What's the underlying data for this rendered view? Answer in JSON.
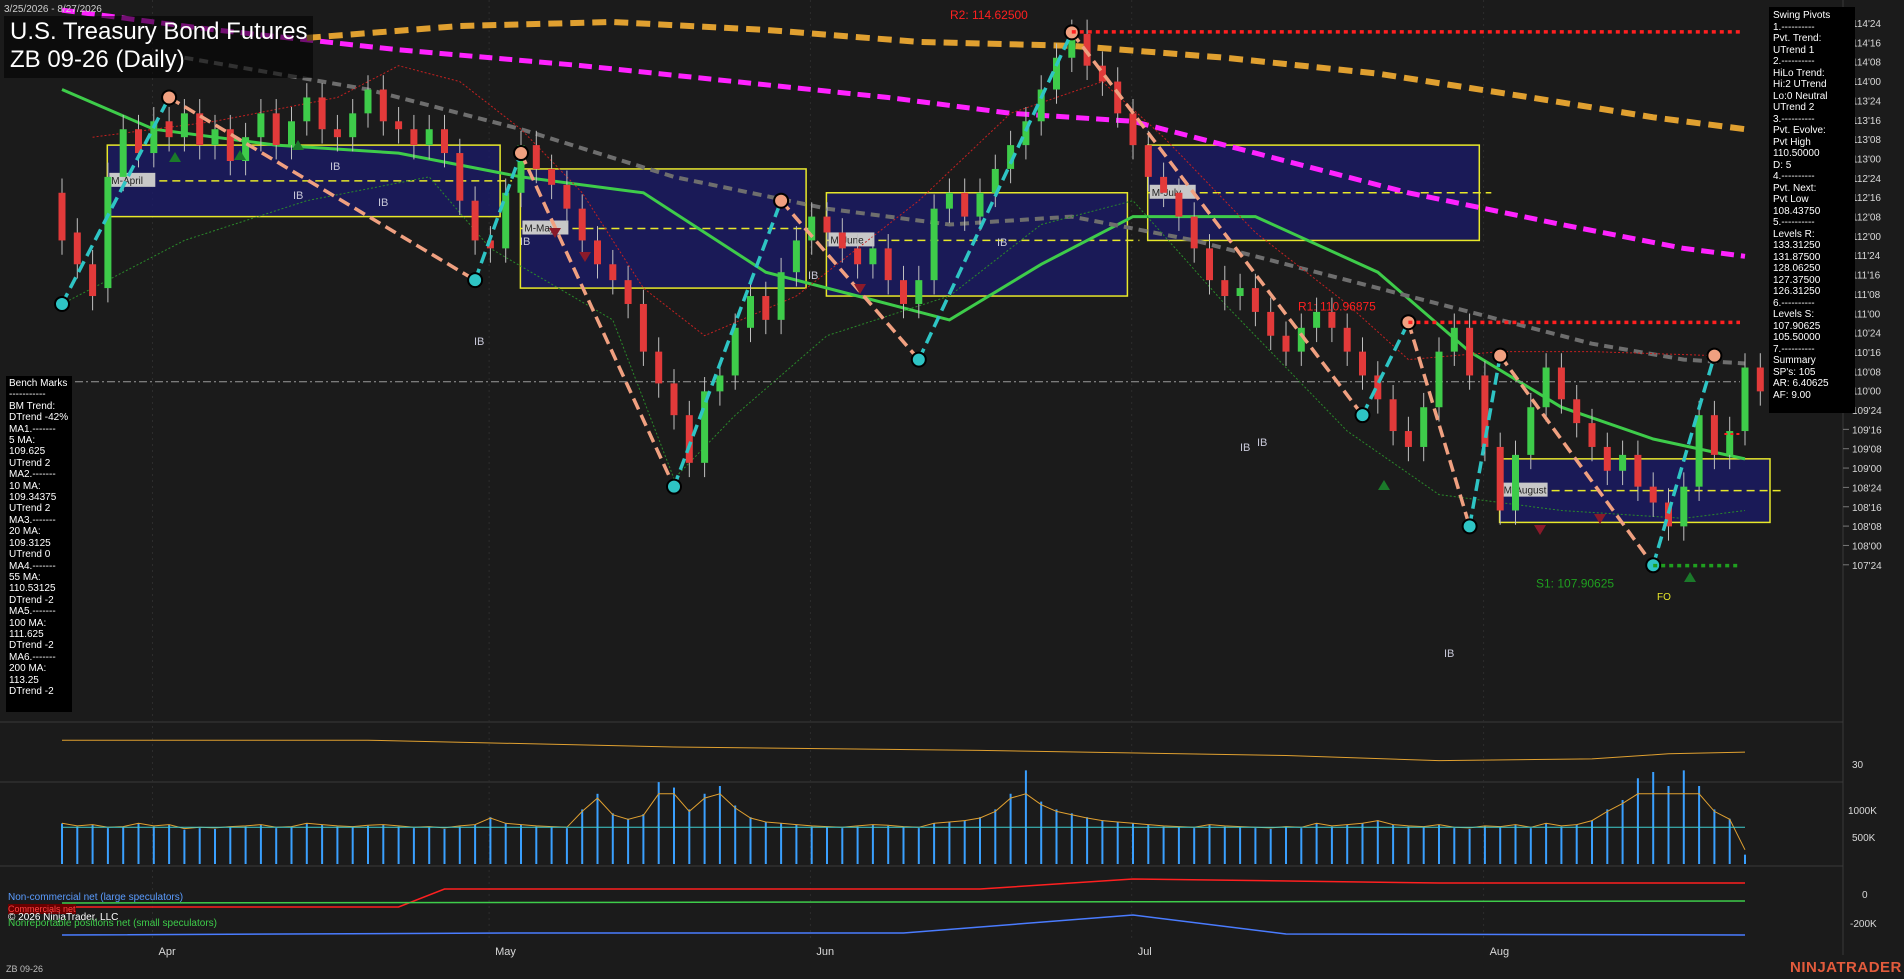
{
  "header": {
    "date_range": "3/25/2026 - 8/27/2026",
    "title": "U.S. Treasury Bond Futures",
    "subtitle": "ZB 09-26 (Daily)"
  },
  "footer": {
    "symbol": "ZB 09-26",
    "brand": "NINJATRADER",
    "copyright": "© 2026 NinjaTrader, LLC",
    "cot_large": "Non-commercial net (large speculators)",
    "cot_commercials": "Commercials net",
    "cot_small": "Nonreportable positions net (small speculators)"
  },
  "bench_marks": [
    "Bench Marks",
    "-----------",
    "BM Trend:",
    "DTrend -42%",
    "MA1.-------",
    "5 MA:",
    "109.625",
    "UTrend 2",
    "MA2.-------",
    "10 MA:",
    "109.34375",
    "UTrend 2",
    "MA3.-------",
    "20 MA:",
    "109.3125",
    "UTrend 0",
    "MA4.-------",
    "55 MA:",
    "110.53125",
    "DTrend -2",
    "MA5.-------",
    "100 MA:",
    "111.625",
    "DTrend -2",
    "MA6.-------",
    "200 MA:",
    "113.25",
    "DTrend -2"
  ],
  "swing_pivots": [
    "Swing Pivots",
    "1.----------",
    "Pvt. Trend:",
    "UTrend 1",
    "2.----------",
    "HiLo Trend:",
    "Hi:2 UTrend",
    "Lo:0 Neutral",
    "UTrend 2",
    "3.----------",
    "Pvt. Evolve:",
    "Pvt High",
    "110.50000",
    "D: 5",
    "4.----------",
    "Pvt. Next:",
    "Pvt Low",
    "108.43750",
    "5.----------",
    "Levels R:",
    "133.31250",
    "131.87500",
    "128.06250",
    "127.37500",
    "126.31250",
    "6.----------",
    "Levels S:",
    "107.90625",
    "105.50000",
    "7.----------",
    "Summary",
    "SP's: 105",
    "AR: 6.40625",
    "AF: 9.00"
  ],
  "price_axis": [
    "114'24",
    "114'16",
    "114'08",
    "114'00",
    "113'24",
    "113'16",
    "113'08",
    "113'00",
    "112'24",
    "112'16",
    "112'08",
    "112'00",
    "111'24",
    "111'16",
    "111'08",
    "111'00",
    "110'24",
    "110'16",
    "110'08",
    "110'00",
    "109'24",
    "109'16",
    "109'08",
    "109'00",
    "108'24",
    "108'16",
    "108'08",
    "108'00",
    "107'24"
  ],
  "month_labels": [
    "Apr",
    "May",
    "Jun",
    "Jul",
    "Aug"
  ],
  "level_labels": {
    "r2": "R2: 114.62500",
    "r1": "R1: 110.96875",
    "s1": "S1: 107.90625"
  },
  "month_boxes": [
    "M-April",
    "M-May",
    "M-June",
    "M-July",
    "M-August"
  ],
  "ib_labels": [
    "IB",
    "IB",
    "IB",
    "IB",
    "IB",
    "IB",
    "IB",
    "IB",
    "IB",
    "IB"
  ],
  "fo_label": "FO",
  "panel2_axis": [
    "30"
  ],
  "volume_axis": [
    "1000K",
    "500K"
  ],
  "cot_axis": [
    "0",
    "-200K"
  ],
  "colors": {
    "background": "#1b1b1b",
    "up_candle": "#3ecc4a",
    "down_candle": "#e23a3a",
    "ma_20": "#3ecc4a",
    "ma_55": "#6e6e6e",
    "ma_100": "#ff22ff",
    "ma_200": "#e0a030",
    "swing_up": "#2ec4c4",
    "swing_down": "#f0a080",
    "box_border": "#e8e82a",
    "box_fill": "#1a1a66",
    "resistance": "#ff2020",
    "support": "#1f9f1f",
    "volume": "#3aa0ff"
  },
  "chart_data": {
    "type": "candlestick",
    "price_range": [
      107.75,
      114.75
    ],
    "points": [
      [
        "2026-03-25",
        112.6,
        112.0
      ],
      [
        "2026-03-26",
        112.1,
        111.7
      ],
      [
        "2026-03-27",
        111.7,
        111.3
      ],
      [
        "2026-03-30",
        111.4,
        112.8
      ],
      [
        "2026-03-31",
        112.8,
        113.4
      ],
      [
        "2026-04-01",
        113.4,
        113.1
      ],
      [
        "2026-04-02",
        113.1,
        113.5
      ],
      [
        "2026-04-03",
        113.5,
        113.3
      ],
      [
        "2026-04-06",
        113.3,
        113.6
      ],
      [
        "2026-04-07",
        113.6,
        113.2
      ],
      [
        "2026-04-08",
        113.2,
        113.4
      ],
      [
        "2026-04-09",
        113.4,
        113.0
      ],
      [
        "2026-04-10",
        113.0,
        113.3
      ],
      [
        "2026-04-13",
        113.3,
        113.6
      ],
      [
        "2026-04-14",
        113.6,
        113.2
      ],
      [
        "2026-04-15",
        113.2,
        113.5
      ],
      [
        "2026-04-16",
        113.5,
        113.8
      ],
      [
        "2026-04-17",
        113.8,
        113.4
      ],
      [
        "2026-04-20",
        113.4,
        113.3
      ],
      [
        "2026-04-21",
        113.3,
        113.6
      ],
      [
        "2026-04-22",
        113.6,
        113.9
      ],
      [
        "2026-04-23",
        113.9,
        113.5
      ],
      [
        "2026-04-24",
        113.5,
        113.4
      ],
      [
        "2026-04-27",
        113.4,
        113.2
      ],
      [
        "2026-04-28",
        113.2,
        113.4
      ],
      [
        "2026-04-29",
        113.4,
        113.1
      ],
      [
        "2026-04-30",
        113.1,
        112.5
      ],
      [
        "2026-05-01",
        112.5,
        112.0
      ],
      [
        "2026-05-04",
        112.0,
        111.9
      ],
      [
        "2026-05-05",
        111.9,
        112.6
      ],
      [
        "2026-05-06",
        112.6,
        113.2
      ],
      [
        "2026-05-07",
        113.2,
        112.9
      ],
      [
        "2026-05-08",
        112.9,
        112.7
      ],
      [
        "2026-05-11",
        112.7,
        112.4
      ],
      [
        "2026-05-12",
        112.4,
        112.0
      ],
      [
        "2026-05-13",
        112.0,
        111.7
      ],
      [
        "2026-05-14",
        111.7,
        111.5
      ],
      [
        "2026-05-15",
        111.5,
        111.2
      ],
      [
        "2026-05-18",
        111.2,
        110.6
      ],
      [
        "2026-05-19",
        110.6,
        110.2
      ],
      [
        "2026-05-20",
        110.2,
        109.8
      ],
      [
        "2026-05-21",
        109.8,
        109.2
      ],
      [
        "2026-05-22",
        109.2,
        110.1
      ],
      [
        "2026-05-25",
        110.1,
        110.3
      ],
      [
        "2026-05-26",
        110.3,
        110.9
      ],
      [
        "2026-05-27",
        110.9,
        111.3
      ],
      [
        "2026-05-28",
        111.3,
        111.0
      ],
      [
        "2026-05-29",
        111.0,
        111.6
      ],
      [
        "2026-06-01",
        111.6,
        112.0
      ],
      [
        "2026-06-02",
        112.0,
        112.3
      ],
      [
        "2026-06-03",
        112.3,
        112.1
      ],
      [
        "2026-06-04",
        112.1,
        111.9
      ],
      [
        "2026-06-05",
        111.9,
        111.7
      ],
      [
        "2026-06-08",
        111.7,
        111.9
      ],
      [
        "2026-06-09",
        111.9,
        111.5
      ],
      [
        "2026-06-10",
        111.5,
        111.2
      ],
      [
        "2026-06-11",
        111.2,
        111.5
      ],
      [
        "2026-06-12",
        111.5,
        112.4
      ],
      [
        "2026-06-15",
        112.4,
        112.6
      ],
      [
        "2026-06-16",
        112.6,
        112.3
      ],
      [
        "2026-06-17",
        112.3,
        112.6
      ],
      [
        "2026-06-18",
        112.6,
        112.9
      ],
      [
        "2026-06-19",
        112.9,
        113.2
      ],
      [
        "2026-06-22",
        113.2,
        113.5
      ],
      [
        "2026-06-23",
        113.5,
        113.9
      ],
      [
        "2026-06-24",
        113.9,
        114.3
      ],
      [
        "2026-06-25",
        114.3,
        114.6
      ],
      [
        "2026-06-26",
        114.6,
        114.2
      ],
      [
        "2026-06-29",
        114.2,
        114.0
      ],
      [
        "2026-06-30",
        114.0,
        113.6
      ],
      [
        "2026-07-01",
        113.6,
        113.2
      ],
      [
        "2026-07-02",
        113.2,
        112.8
      ],
      [
        "2026-07-03",
        112.8,
        112.6
      ],
      [
        "2026-07-06",
        112.6,
        112.3
      ],
      [
        "2026-07-07",
        112.3,
        111.9
      ],
      [
        "2026-07-08",
        111.9,
        111.5
      ],
      [
        "2026-07-09",
        111.5,
        111.3
      ],
      [
        "2026-07-10",
        111.3,
        111.4
      ],
      [
        "2026-07-13",
        111.4,
        111.1
      ],
      [
        "2026-07-14",
        111.1,
        110.8
      ],
      [
        "2026-07-15",
        110.8,
        110.6
      ],
      [
        "2026-07-16",
        110.6,
        110.9
      ],
      [
        "2026-07-17",
        110.9,
        111.1
      ],
      [
        "2026-07-20",
        111.1,
        110.9
      ],
      [
        "2026-07-21",
        110.9,
        110.6
      ],
      [
        "2026-07-22",
        110.6,
        110.3
      ],
      [
        "2026-07-23",
        110.3,
        110.0
      ],
      [
        "2026-07-24",
        110.0,
        109.6
      ],
      [
        "2026-07-27",
        109.6,
        109.4
      ],
      [
        "2026-07-28",
        109.4,
        109.9
      ],
      [
        "2026-07-29",
        109.9,
        110.6
      ],
      [
        "2026-07-30",
        110.6,
        110.9
      ],
      [
        "2026-07-31",
        110.9,
        110.3
      ],
      [
        "2026-08-03",
        110.3,
        109.4
      ],
      [
        "2026-08-04",
        109.4,
        108.6
      ],
      [
        "2026-08-05",
        108.6,
        109.3
      ],
      [
        "2026-08-06",
        109.3,
        109.9
      ],
      [
        "2026-08-07",
        109.9,
        110.4
      ],
      [
        "2026-08-10",
        110.4,
        110.0
      ],
      [
        "2026-08-11",
        110.0,
        109.7
      ],
      [
        "2026-08-12",
        109.7,
        109.4
      ],
      [
        "2026-08-13",
        109.4,
        109.1
      ],
      [
        "2026-08-14",
        109.1,
        109.3
      ],
      [
        "2026-08-17",
        109.3,
        108.9
      ],
      [
        "2026-08-18",
        108.9,
        108.7
      ],
      [
        "2026-08-19",
        108.7,
        108.4
      ],
      [
        "2026-08-20",
        108.4,
        108.9
      ],
      [
        "2026-08-21",
        108.9,
        109.8
      ],
      [
        "2026-08-24",
        109.8,
        109.3
      ],
      [
        "2026-08-25",
        109.3,
        109.6
      ],
      [
        "2026-08-26",
        109.6,
        110.4
      ],
      [
        "2026-08-27",
        110.4,
        110.1
      ]
    ],
    "moving_averages": [
      {
        "name": "20 MA",
        "values": [
          [
            0,
            113.9
          ],
          [
            6,
            113.4
          ],
          [
            14,
            113.2
          ],
          [
            22,
            113.1
          ],
          [
            30,
            112.8
          ],
          [
            38,
            112.6
          ],
          [
            46,
            111.6
          ],
          [
            52,
            111.3
          ],
          [
            58,
            111.0
          ],
          [
            64,
            111.7
          ],
          [
            70,
            112.3
          ],
          [
            78,
            112.3
          ],
          [
            86,
            111.6
          ],
          [
            92,
            110.6
          ],
          [
            98,
            109.9
          ],
          [
            104,
            109.5
          ],
          [
            110,
            109.25
          ]
        ]
      },
      {
        "name": "55 MA",
        "values": [
          [
            8,
            114.3
          ],
          [
            20,
            113.9
          ],
          [
            30,
            113.4
          ],
          [
            40,
            112.8
          ],
          [
            50,
            112.4
          ],
          [
            58,
            112.2
          ],
          [
            66,
            112.3
          ],
          [
            74,
            112.0
          ],
          [
            82,
            111.6
          ],
          [
            92,
            111.1
          ],
          [
            100,
            110.7
          ],
          [
            106,
            110.5
          ],
          [
            110,
            110.45
          ]
        ]
      },
      {
        "name": "100 MA",
        "values": [
          [
            0,
            114.9
          ],
          [
            10,
            114.65
          ],
          [
            22,
            114.4
          ],
          [
            34,
            114.2
          ],
          [
            44,
            114.0
          ],
          [
            54,
            113.8
          ],
          [
            62,
            113.6
          ],
          [
            70,
            113.5
          ],
          [
            78,
            113.1
          ],
          [
            88,
            112.6
          ],
          [
            98,
            112.2
          ],
          [
            106,
            111.9
          ],
          [
            110,
            111.8
          ]
        ]
      },
      {
        "name": "200 MA",
        "values": [
          [
            16,
            114.55
          ],
          [
            26,
            114.7
          ],
          [
            36,
            114.75
          ],
          [
            46,
            114.65
          ],
          [
            56,
            114.5
          ],
          [
            66,
            114.45
          ],
          [
            76,
            114.3
          ],
          [
            86,
            114.1
          ],
          [
            96,
            113.8
          ],
          [
            104,
            113.55
          ],
          [
            110,
            113.4
          ]
        ]
      }
    ],
    "swing_pivots": [
      [
        0,
        111.2,
        "low"
      ],
      [
        7,
        113.8,
        "high"
      ],
      [
        27,
        111.5,
        "low"
      ],
      [
        30,
        113.1,
        "high"
      ],
      [
        40,
        108.9,
        "low"
      ],
      [
        47,
        112.5,
        "high"
      ],
      [
        56,
        110.5,
        "low"
      ],
      [
        66,
        114.62,
        "high"
      ],
      [
        85,
        109.8,
        "low"
      ],
      [
        88,
        110.97,
        "high"
      ],
      [
        92,
        108.4,
        "low"
      ],
      [
        94,
        110.55,
        "high"
      ],
      [
        104,
        107.91,
        "low"
      ],
      [
        108,
        110.55,
        "high"
      ]
    ],
    "month_value_areas": [
      {
        "name": "M-April",
        "top": 113.2,
        "bottom": 112.3,
        "mid": 112.75,
        "start": 1,
        "end": 27
      },
      {
        "name": "M-May",
        "top": 112.9,
        "bottom": 111.4,
        "mid": 112.15,
        "start": 28,
        "end": 47
      },
      {
        "name": "M-June",
        "top": 112.6,
        "bottom": 111.3,
        "mid": 112.0,
        "start": 48,
        "end": 68
      },
      {
        "name": "M-July",
        "top": 113.2,
        "bottom": 112.0,
        "mid": 112.6,
        "start": 69,
        "end": 91
      },
      {
        "name": "M-August",
        "top": 109.25,
        "bottom": 108.45,
        "mid": 108.85,
        "start": 92,
        "end": 110
      }
    ],
    "levels": {
      "R2": 114.625,
      "R1": 110.96875,
      "S1": 107.90625
    },
    "current_price_line": 110.22,
    "volume_k": [
      520,
      480,
      500,
      460,
      470,
      520,
      480,
      500,
      440,
      460,
      450,
      470,
      480,
      500,
      460,
      470,
      520,
      500,
      480,
      470,
      490,
      500,
      480,
      460,
      470,
      450,
      480,
      500,
      600,
      520,
      500,
      480,
      470,
      460,
      700,
      900,
      650,
      580,
      640,
      1050,
      980,
      700,
      900,
      1000,
      750,
      600,
      540,
      520,
      500,
      480,
      470,
      460,
      480,
      500,
      490,
      470,
      460,
      520,
      540,
      560,
      600,
      700,
      900,
      1200,
      800,
      700,
      650,
      600,
      560,
      540,
      520,
      500,
      480,
      470,
      460,
      500,
      480,
      470,
      460,
      450,
      470,
      460,
      520,
      480,
      500,
      520,
      560,
      500,
      480,
      470,
      500,
      460,
      450,
      480,
      470,
      500,
      460,
      520,
      480,
      500,
      560,
      700,
      820,
      1100,
      1180,
      1000,
      1200,
      1000,
      700,
      580,
      120
    ],
    "panel2_line": [
      [
        0,
        44
      ],
      [
        20,
        44
      ],
      [
        40,
        40
      ],
      [
        60,
        38
      ],
      [
        80,
        35
      ],
      [
        90,
        32
      ],
      [
        100,
        33
      ],
      [
        105,
        36
      ],
      [
        110,
        37
      ]
    ],
    "cot_large": [
      [
        0,
        -200
      ],
      [
        30,
        -190
      ],
      [
        55,
        -190
      ],
      [
        70,
        -100
      ],
      [
        80,
        -195
      ],
      [
        110,
        -200
      ]
    ],
    "cot_commercials": [
      [
        0,
        -60
      ],
      [
        22,
        -60
      ],
      [
        25,
        30
      ],
      [
        60,
        30
      ],
      [
        70,
        80
      ],
      [
        90,
        60
      ],
      [
        110,
        60
      ]
    ],
    "cot_small": [
      [
        0,
        -40
      ],
      [
        110,
        -30
      ]
    ]
  }
}
